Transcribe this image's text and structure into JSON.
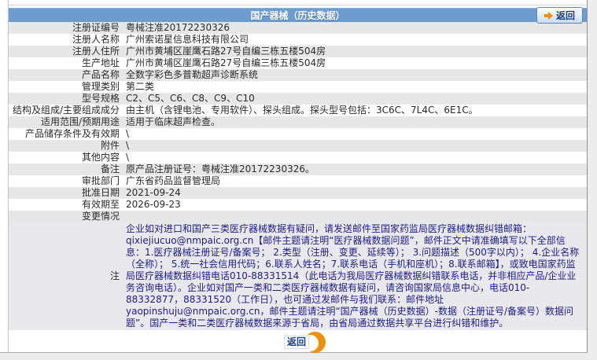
{
  "header": {
    "title": "国产器械（历史数据）",
    "back_label": "返回"
  },
  "table": {
    "rows": [
      {
        "label": "注册证编号",
        "value": "粤械注准20172230326"
      },
      {
        "label": "注册人名称",
        "value": "广州索诺星信息科技有限公司"
      },
      {
        "label": "注册人住所",
        "value": "广州市黄埔区崖鹰石路27号自编三栋五楼504房"
      },
      {
        "label": "生产地址",
        "value": "广州市黄埔区崖鹰石路27号自编三栋五楼504房"
      },
      {
        "label": "产品名称",
        "value": "全数字彩色多普勒超声诊断系统"
      },
      {
        "label": "管理类别",
        "value": "第二类"
      },
      {
        "label": "型号规格",
        "value": "C2、C5、C6、C8、C9、C10"
      },
      {
        "label": "结构及组成/主要组成成分",
        "value": "由主机（含锂电池、专用软件）、探头组成。探头型号包括：3C6C、7L4C、6E1C。"
      },
      {
        "label": "适用范围/预期用途",
        "value": "适用于临床超声检查。"
      },
      {
        "label": "产品储存条件及有效期",
        "value": "\\"
      },
      {
        "label": "附件",
        "value": "\\"
      },
      {
        "label": "其他内容",
        "value": "\\"
      },
      {
        "label": "备注",
        "value": "原产品注册证号：粤械注准20172230326。"
      },
      {
        "label": "审批部门",
        "value": "广东省药品监督管理局"
      },
      {
        "label": "批准日期",
        "value": "2021-09-24"
      },
      {
        "label": "有效期至",
        "value": "2026-09-23"
      },
      {
        "label": "变更情况",
        "value": ""
      },
      {
        "label": "注",
        "value": "企业如对进口和国产三类医疗器械数据有疑问，请发送邮件至国家药监局医疗器械数据纠错邮箱：qixiejiucuo@nmpaic.org.cn【邮件主题请注明“医疗器械数据问题”，邮件正文中请准确填写以下全部信息：1.医疗器械注册证号/备案号； 2.类型（注册、变更、延续等）； 3.问题描述（500字以内）； 4.企业名称（全称）； 5.统一社会信用代码；6.联系人姓名；7.联系电话（手机和座机）；8.联系邮箱】，或致电国家药监局医疗器械数据纠错电话010-88331514（此电话为我局医疗器械数据纠错联系电话，并非相应产品/企业业务咨询电话）。企业如对国产一类和二类医疗器械数据有疑问，请咨询国家局信息中心，电话010-88332877，88331520（工作日），也可通过发邮件与我们联系：邮件地址yaopinshuju@nmpaic.org.cn，邮件主题请注明“国产器械（历史数据）-数据（注册证号/备案号）数据问题”。国产一类和二类医疗器械数据来源于省局，由省局通过数据共享平台进行纠错和维护。"
      }
    ]
  },
  "footer": {
    "back_label": "返回"
  },
  "colors": {
    "header_bg": "#6d9dcf",
    "stripe": "#e7e7e7",
    "note_bg": "#e9e9ed",
    "note_text": "#1c1c8a",
    "accent_orange": "#ef8f0d",
    "button_text": "#16407c"
  }
}
